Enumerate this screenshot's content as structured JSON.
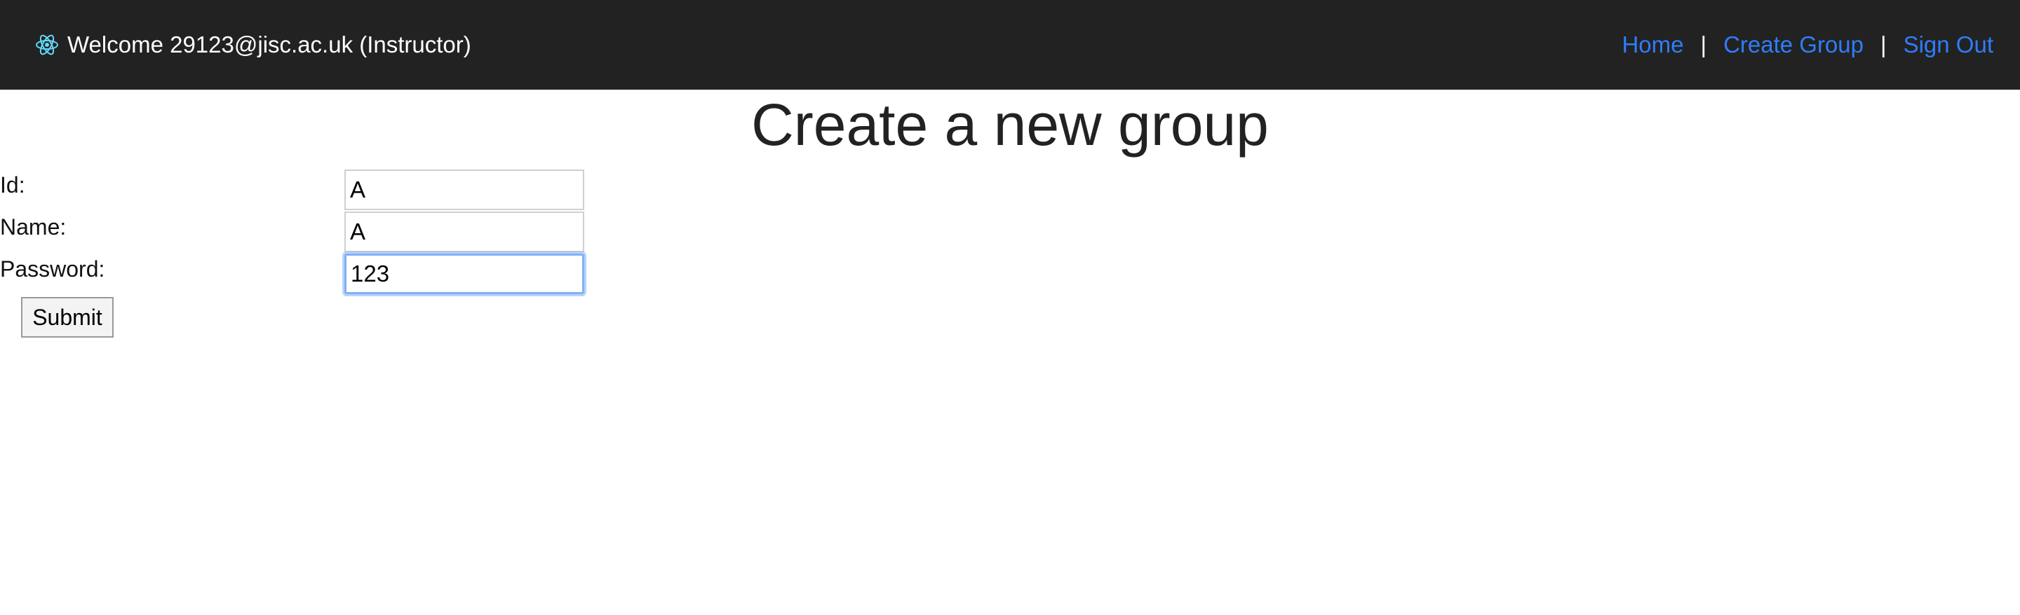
{
  "navbar": {
    "logo_icon": "react-atom-icon",
    "logo_color": "#61dafb",
    "welcome_text": "Welcome 29123@jisc.ac.uk (Instructor)",
    "links": {
      "home": "Home",
      "create_group": "Create Group",
      "sign_out": "Sign Out",
      "separator": "|"
    },
    "link_color": "#2f7dfc",
    "background": "#222222"
  },
  "page": {
    "title": "Create a new group"
  },
  "form": {
    "id_label": "Id:",
    "id_value": "A",
    "name_label": "Name:",
    "name_value": "A",
    "password_label": "Password:",
    "password_value": "123",
    "submit_label": "Submit"
  }
}
